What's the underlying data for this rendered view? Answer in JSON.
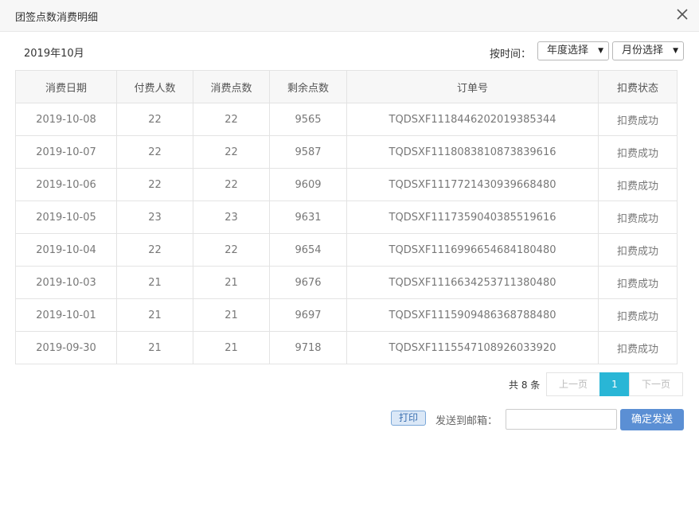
{
  "dialog": {
    "title": "团签点数消费明细"
  },
  "period": "2019年10月",
  "filter": {
    "label": "按时间：",
    "year_select": "年度选择",
    "month_select": "月份选择"
  },
  "table": {
    "headers": [
      "消费日期",
      "付费人数",
      "消费点数",
      "剩余点数",
      "订单号",
      "扣费状态"
    ],
    "rows": [
      [
        "2019-10-08",
        "22",
        "22",
        "9565",
        "TQDSXF1118446202019385344",
        "扣费成功"
      ],
      [
        "2019-10-07",
        "22",
        "22",
        "9587",
        "TQDSXF1118083810873839616",
        "扣费成功"
      ],
      [
        "2019-10-06",
        "22",
        "22",
        "9609",
        "TQDSXF1117721430939668480",
        "扣费成功"
      ],
      [
        "2019-10-05",
        "23",
        "23",
        "9631",
        "TQDSXF1117359040385519616",
        "扣费成功"
      ],
      [
        "2019-10-04",
        "22",
        "22",
        "9654",
        "TQDSXF1116996654684180480",
        "扣费成功"
      ],
      [
        "2019-10-03",
        "21",
        "21",
        "9676",
        "TQDSXF1116634253711380480",
        "扣费成功"
      ],
      [
        "2019-10-01",
        "21",
        "21",
        "9697",
        "TQDSXF1115909486368788480",
        "扣费成功"
      ],
      [
        "2019-09-30",
        "21",
        "21",
        "9718",
        "TQDSXF1115547108926033920",
        "扣费成功"
      ]
    ]
  },
  "pagination": {
    "total": "共 8 条",
    "prev": "上一页",
    "current": "1",
    "next": "下一页"
  },
  "actions": {
    "print": "打印",
    "email_label": "发送到邮箱：",
    "email_value": "",
    "send": "确定发送"
  },
  "colors": {
    "active_page": "#29b6d6",
    "send_button": "#5b8fd4"
  },
  "icons": {
    "close": "close-icon",
    "caret": "caret-down-icon"
  }
}
